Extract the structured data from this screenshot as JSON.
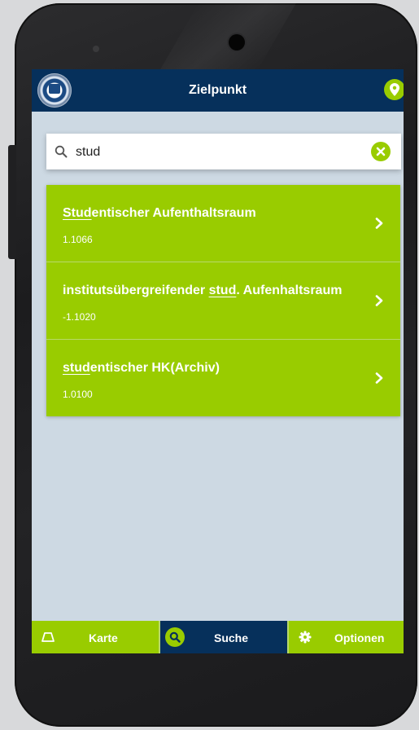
{
  "header": {
    "title": "Zielpunkt",
    "logo_icon": "university-seal-icon",
    "location_icon": "map-marker-icon"
  },
  "search": {
    "value": "stud",
    "placeholder": "",
    "search_icon": "search-icon",
    "clear_icon": "clear-circle-icon"
  },
  "results": [
    {
      "pre": "",
      "highlight": "Stud",
      "post": "entischer Aufenthaltsraum",
      "room": "1.1066"
    },
    {
      "pre": "institutsübergreifender ",
      "highlight": "stud",
      "post": ". Aufenhaltsraum",
      "room": "-1.1020"
    },
    {
      "pre": "",
      "highlight": "stud",
      "post": "entischer HK(Archiv)",
      "room": "1.0100"
    }
  ],
  "navbar": {
    "karte": "Karte",
    "suche": "Suche",
    "optionen": "Optionen",
    "active": "suche"
  },
  "colors": {
    "primary": "#06305b",
    "accent": "#99cc00",
    "background": "#cdd9e3"
  }
}
